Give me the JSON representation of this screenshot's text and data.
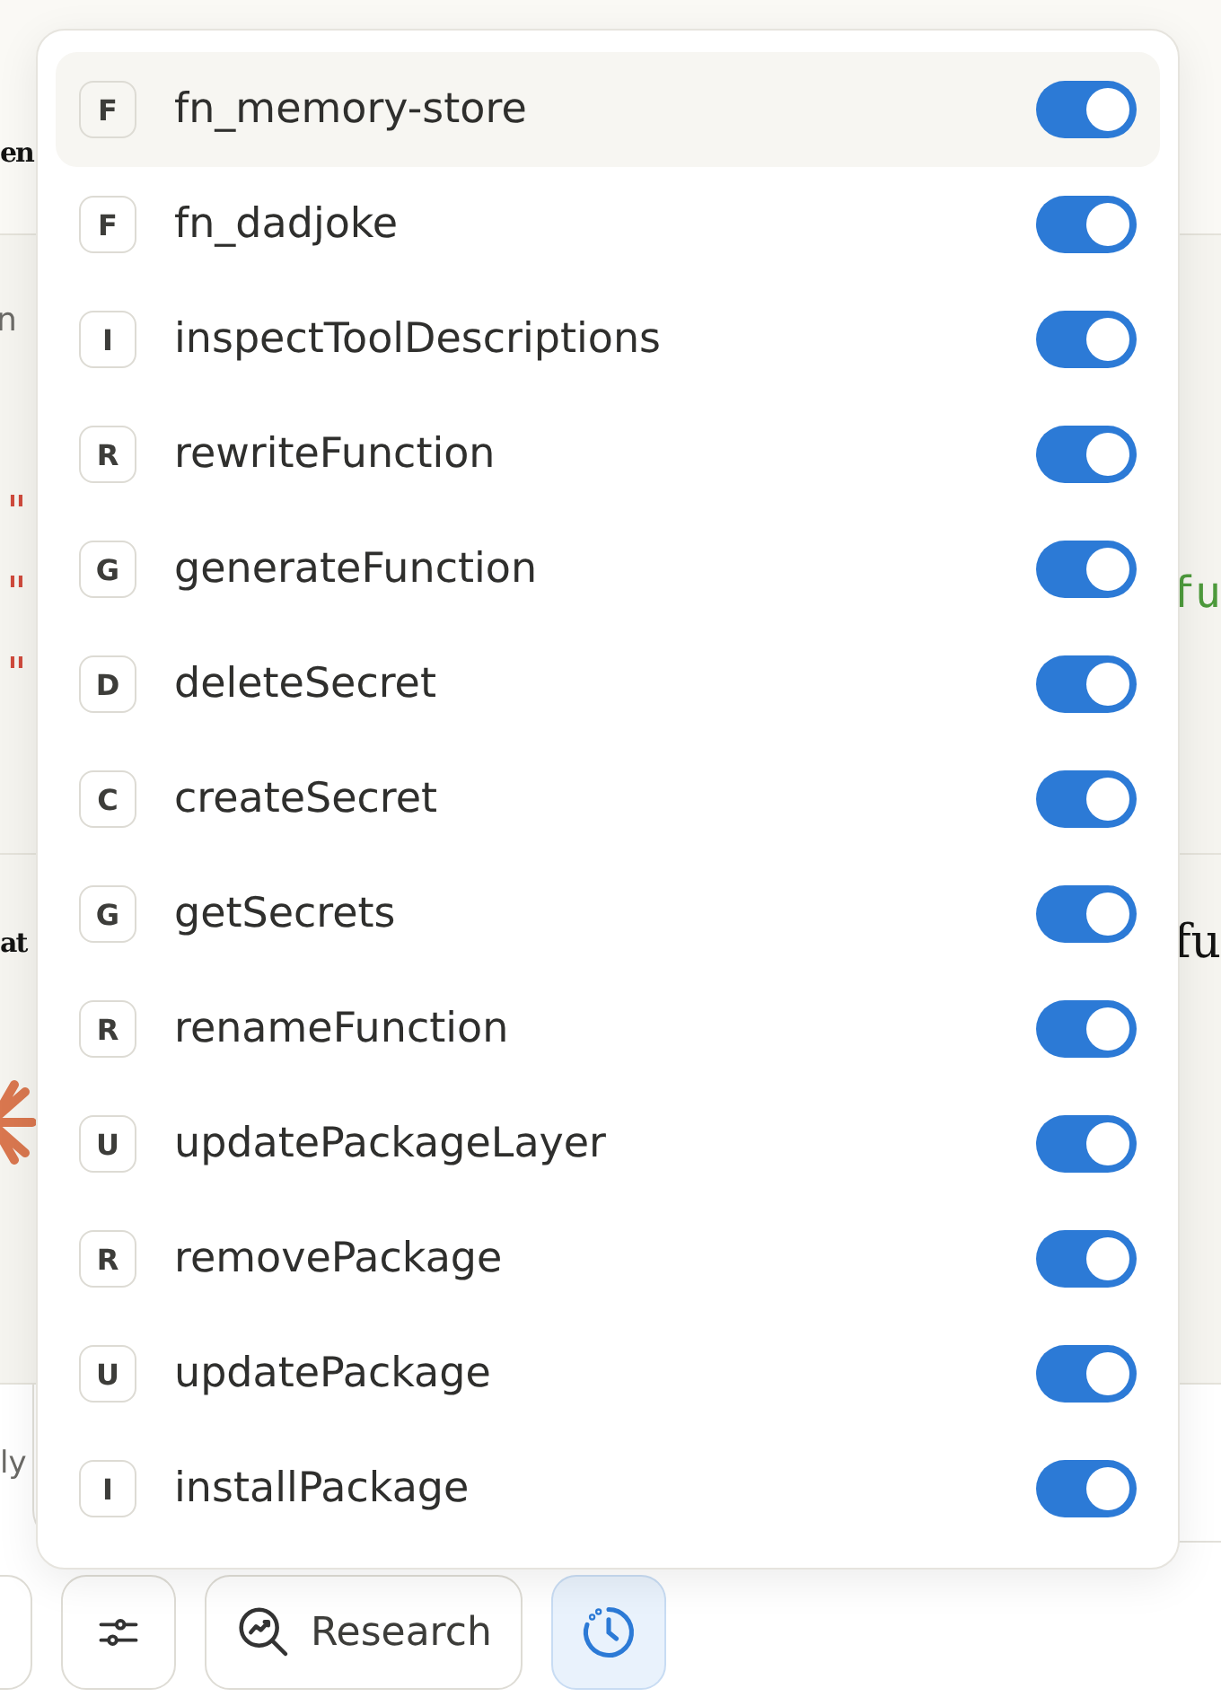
{
  "background": {
    "title_fragment": "en",
    "caption_fragment": "n",
    "code_lines": [
      {
        "text": "\""
      },
      {
        "text": "\"",
        "right": "fu"
      },
      {
        "text": "\""
      }
    ],
    "section_heading": {
      "left": "at",
      "right": "fu"
    },
    "input_fragment": "ly"
  },
  "menu": {
    "items": [
      {
        "badge": "F",
        "label": "fn_memory-store",
        "on": true,
        "selected": true
      },
      {
        "badge": "F",
        "label": "fn_dadjoke",
        "on": true,
        "selected": false
      },
      {
        "badge": "I",
        "label": "inspectToolDescriptions",
        "on": true,
        "selected": false
      },
      {
        "badge": "R",
        "label": "rewriteFunction",
        "on": true,
        "selected": false
      },
      {
        "badge": "G",
        "label": "generateFunction",
        "on": true,
        "selected": false
      },
      {
        "badge": "D",
        "label": "deleteSecret",
        "on": true,
        "selected": false
      },
      {
        "badge": "C",
        "label": "createSecret",
        "on": true,
        "selected": false
      },
      {
        "badge": "G",
        "label": "getSecrets",
        "on": true,
        "selected": false
      },
      {
        "badge": "R",
        "label": "renameFunction",
        "on": true,
        "selected": false
      },
      {
        "badge": "U",
        "label": "updatePackageLayer",
        "on": true,
        "selected": false
      },
      {
        "badge": "R",
        "label": "removePackage",
        "on": true,
        "selected": false
      },
      {
        "badge": "U",
        "label": "updatePackage",
        "on": true,
        "selected": false
      },
      {
        "badge": "I",
        "label": "installPackage",
        "on": true,
        "selected": false
      }
    ]
  },
  "toolbar": {
    "buttons": [
      {
        "kind": "edge",
        "selected": false
      },
      {
        "kind": "sliders",
        "selected": false
      },
      {
        "kind": "research",
        "label": "Research",
        "selected": false
      },
      {
        "kind": "clock",
        "selected": true
      }
    ]
  }
}
